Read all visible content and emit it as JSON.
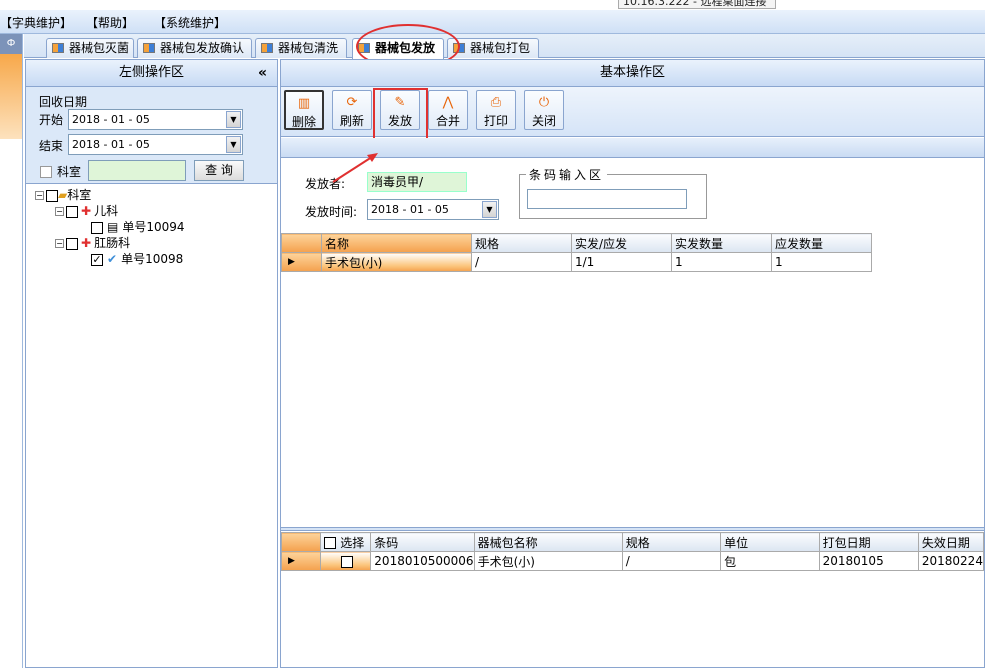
{
  "remote_label": "10.16.3.222 - 远程桌面连接",
  "menu": [
    "【字典维护】",
    "【帮助】",
    "【系统维护】"
  ],
  "pin_glyph": "Ф",
  "tabs": [
    "器械包灭菌",
    "器械包发放确认",
    "器械包清洗",
    "器械包发放",
    "器械包打包"
  ],
  "left": {
    "title": "左侧操作区",
    "collapse": "«",
    "recv_label": "回收日期",
    "start_label": "开始",
    "start_date": "2018 - 01 - 05",
    "end_label": "结束",
    "end_date": "2018 - 01 - 05",
    "dept_label": "科室",
    "dept_value": "",
    "query": "查 询",
    "tree": {
      "root": "科室",
      "n1": "儿科",
      "n1a": "单号10094",
      "n2": "肛肠科",
      "n2a": "单号10098"
    }
  },
  "right": {
    "title": "基本操作区",
    "toolbar": [
      {
        "label": "删除",
        "icon": "trash-icon"
      },
      {
        "label": "刷新",
        "icon": "refresh-icon"
      },
      {
        "label": "发放",
        "icon": "issue-icon"
      },
      {
        "label": "合并",
        "icon": "merge-icon"
      },
      {
        "label": "打印",
        "icon": "printer-icon"
      },
      {
        "label": "关闭",
        "icon": "power-icon"
      }
    ],
    "issuer_label": "发放者:",
    "issuer_value": "消毒员甲/",
    "time_label": "发放时间:",
    "time_value": "2018 - 01 - 05",
    "barcode_legend": "条码输入区",
    "barcode_value": ""
  },
  "grid1": {
    "headers": [
      "名称",
      "规格",
      "实发/应发",
      "实发数量",
      "应发数量"
    ],
    "rows": [
      [
        "手术包(小)",
        "/",
        "1/1",
        "1",
        "1"
      ]
    ]
  },
  "grid2": {
    "headers": [
      "选择",
      "条码",
      "器械包名称",
      "规格",
      "单位",
      "打包日期",
      "失效日期"
    ],
    "rows": [
      [
        "",
        "2018010500006",
        "手术包(小)",
        "/",
        "包",
        "20180105",
        "20180224"
      ]
    ]
  },
  "colors": {
    "accent": "#f4a14d",
    "annotation": "#e03030",
    "header": "#c7daf4"
  }
}
